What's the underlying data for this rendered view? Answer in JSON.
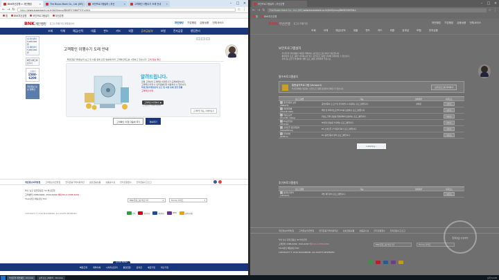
{
  "left_window": {
    "tabs": [
      {
        "label": "BNK부산은행 > 개인뱅킹",
        "active": true
      },
      {
        "label": "The Busan Bank Co., Ltd. [KR]",
        "active": false
      },
      {
        "label": "보안프로그램설치 | 부산",
        "active": false
      },
      {
        "label": "고객확인 이행수기 도래 안내",
        "active": false
      }
    ],
    "url_secure": "https://",
    "url": "www.busanbank.co.kr/ib20/mnu/IBKBPOT/IBKPTOTL0001",
    "bookmarks": [
      "앱",
      "BNK부산은행",
      "보안프로그램설치",
      "부산은행"
    ],
    "site": {
      "logo": "BNK",
      "logo_sub": "개인뱅킹",
      "util": "로그인 회원가입 영업점안내",
      "top_nav": [
        "개인뱅킹",
        "기업뱅킹",
        "금융상품",
        "전체서비스"
      ],
      "menu": [
        "조회",
        "이체",
        "예금/신탁",
        "대출",
        "펀드",
        "카드",
        "외환",
        "공과금납부",
        "보험",
        "전자금융",
        "뱅킹관리"
      ],
      "left_panel": {
        "items": [
          "내 자산관리",
          "5,000,000원",
          "내 계좌관리",
          "5,000,000원"
        ],
        "quick_label": "빠른서비스바로가기",
        "call_label": "고객센터",
        "call_num": "1588-6200",
        "banner": "개인정보 보호 캠페인"
      },
      "page_title": "고객확인 이행수기 도래 안내",
      "notice": "· 특정금융거래정보의 보고 및 이용 등에 관한 법률에 따라 고객확인제도를 시행하고 있습니다.",
      "notice_red": "고객 정보 확인",
      "hero_title": "알려드립니다.",
      "hero_p1": "현재 고객님의 고객확인 이행주기가 도래하였습니다.",
      "hero_p2": "고객확인 이행 시 인터넷뱅킹을 이용하실 수 있습니다.",
      "hero_blue": "특정금융거래정보의 보고 및 이용 등에 관한 법률",
      "hero_red": "고객확인 이행",
      "hero_btn": "고객확인 이행하기 ▶",
      "hero_small": "· 고객센터 1588-6200",
      "hero_more": "고객확인 제도 자세히보기",
      "btn_later": "고객확인 이행 다음에 하기",
      "btn_do": "계속하기"
    },
    "footer": {
      "links": [
        "개인정보처리방침",
        "고객정보취급방침",
        "전자금융거래이용약관",
        "보호금융상품",
        "상품공시실",
        "전자민원접수",
        "전자금융사고신고",
        "전자금융사기예방서비스"
      ],
      "info1": "부산 남구 문현금융로 30 부산은행",
      "tel1": "고객센터 1588-6200, 1544-6200",
      "tel2": "해외 82-2-1588-6200",
      "biz": "TALK상담 채팅상담 FAQ",
      "copyright": "COPYRIGHT © 2016 BUSANBANK, ALL RIGHTS RESERVED.",
      "select1": "BNK금융그룹 바로가기",
      "select2": "Family 사이트",
      "certs": [
        "인증",
        "정보보호",
        "개인정보",
        "ISMS",
        "금융보안원"
      ],
      "quick_tag": "QUICK MENU",
      "quick": [
        "빠른조회",
        "계좌이체",
        "나의자산관리",
        "통장전환",
        "공과금",
        "예금가입",
        "대출가입"
      ]
    }
  },
  "right_window": {
    "tabs": [
      {
        "label": "보안프로그램설치 | 부산은행",
        "active": true
      }
    ],
    "url_secure": "The Busan Bank Co., Ltd. [KR]",
    "url": "www.busanbank.co.kr/ib20/mnu/IBKSECINSTALL",
    "bookmarks": [
      "앱",
      "BNK부산은행"
    ],
    "site": {
      "logo": "BNK",
      "logo_sub": "부산은행",
      "util": "로그인 회원가입",
      "top_nav": [
        "개인뱅킹",
        "기업뱅킹",
        "금융상품",
        "전체서비스"
      ],
      "menu": [
        "조회",
        "이체",
        "예금/신탁",
        "대출",
        "펀드",
        "카드",
        "외환",
        "공과금",
        "보험",
        "전자금융"
      ],
      "page_title": "보안프로그램설치",
      "desc": [
        "· 부산은행 인터넷뱅킹 이용을 위해서는 보안프로그램 설치가 필요합니다.",
        "· 통합설치 프로그램을 설치하시면 필수 보안프로그램을 한번에 설치하실 수 있습니다.",
        "· 설치 중 오류가 발생하면 개별 프로그램을 설치하여 주십시오."
      ],
      "sub_required": "필수프로그램설치",
      "card_title": "통합설치프로그램 (Veraport)",
      "card_desc": "부산은행에서 제공하는 보안프로그램을 통합하여 설치할 수 있습니다.",
      "card_btn": "보안프로그램 설치하기",
      "table_headers": [
        "프로그램명",
        "기능",
        "설치여부",
        "다운로드"
      ],
      "rows": [
        {
          "name": "공인인증서 보안",
          "sub": "(INISAFE)",
          "func": "공인인증서 로그인 및 전자서명 시 사용되는 프로그램입니다.",
          "status": "설치됨",
          "dl": "다운로드"
        },
        {
          "name": "개인방화벽",
          "sub": "(AhnLab Safe)",
          "func": "해킹 및 바이러스로부터 PC를 보호하는 프로그램입니다.",
          "status": "",
          "dl": "다운로드"
        },
        {
          "name": "키보드보안",
          "sub": "(TouchEn nxKey)",
          "func": "키보드 입력 정보를 암호화하여 보호하는 프로그램입니다.",
          "status": "",
          "dl": "다운로드"
        },
        {
          "name": "PC보안진단",
          "sub": "(IPinside)",
          "func": "PC환경 정보를 수집하는 프로그램입니다.",
          "status": "",
          "dl": "다운로드"
        },
        {
          "name": "스마트폰 공인인증서",
          "sub": "(SGCertMove)",
          "func": "PC-스마트폰 간 인증서 복사 프로그램입니다.",
          "status": "",
          "dl": "다운로드"
        },
        {
          "name": "전자서명",
          "sub": "(Delfino)",
          "func": "PC 공인인증서 관리 프로그램입니다.",
          "status": "",
          "dl": "다운로드"
        }
      ],
      "installing": "Installing...",
      "sub_optional": "추가프로그램설치",
      "opt_rows": [
        {
          "name": "통합자산관리",
          "sub": "(nProtect)",
          "func": "개인 재무관리 프로그램입니다.",
          "status": "",
          "dl": "다운로드"
        }
      ],
      "footer_links": [
        "개인정보처리방침",
        "고객정보취급방침",
        "전자금융거래이용약관",
        "보호금융상품",
        "상품공시실",
        "전자민원접수",
        "전자금융사고신고",
        "전자금융사기예방서비스"
      ],
      "footer_info": "부산 남구 문현금융로 30 부산은행",
      "footer_tel": "고객센터 1588-6200, 1544-6200",
      "footer_tel2": "해외 82-2-1588-6200",
      "footer_biz": "TALK상담 채팅상담 FAQ",
      "footer_copy": "COPYRIGHT © 2016 BUSANBANK, ALL RIGHTS RESERVED.",
      "select1": "BNK금융그룹 바로가기",
      "select2": "Family 사이트"
    },
    "watermark": "blog.com"
  },
  "taskbar": {
    "items": [
      "부산은행 개인뱅킹 - Chrome",
      "보안프로그램설치 - Chrome"
    ],
    "clock": "오전 11:24"
  },
  "colors": {
    "bnk_red": "#d0021b",
    "bnk_navy": "#19377a",
    "hero_blue": "#2aa7d8"
  }
}
